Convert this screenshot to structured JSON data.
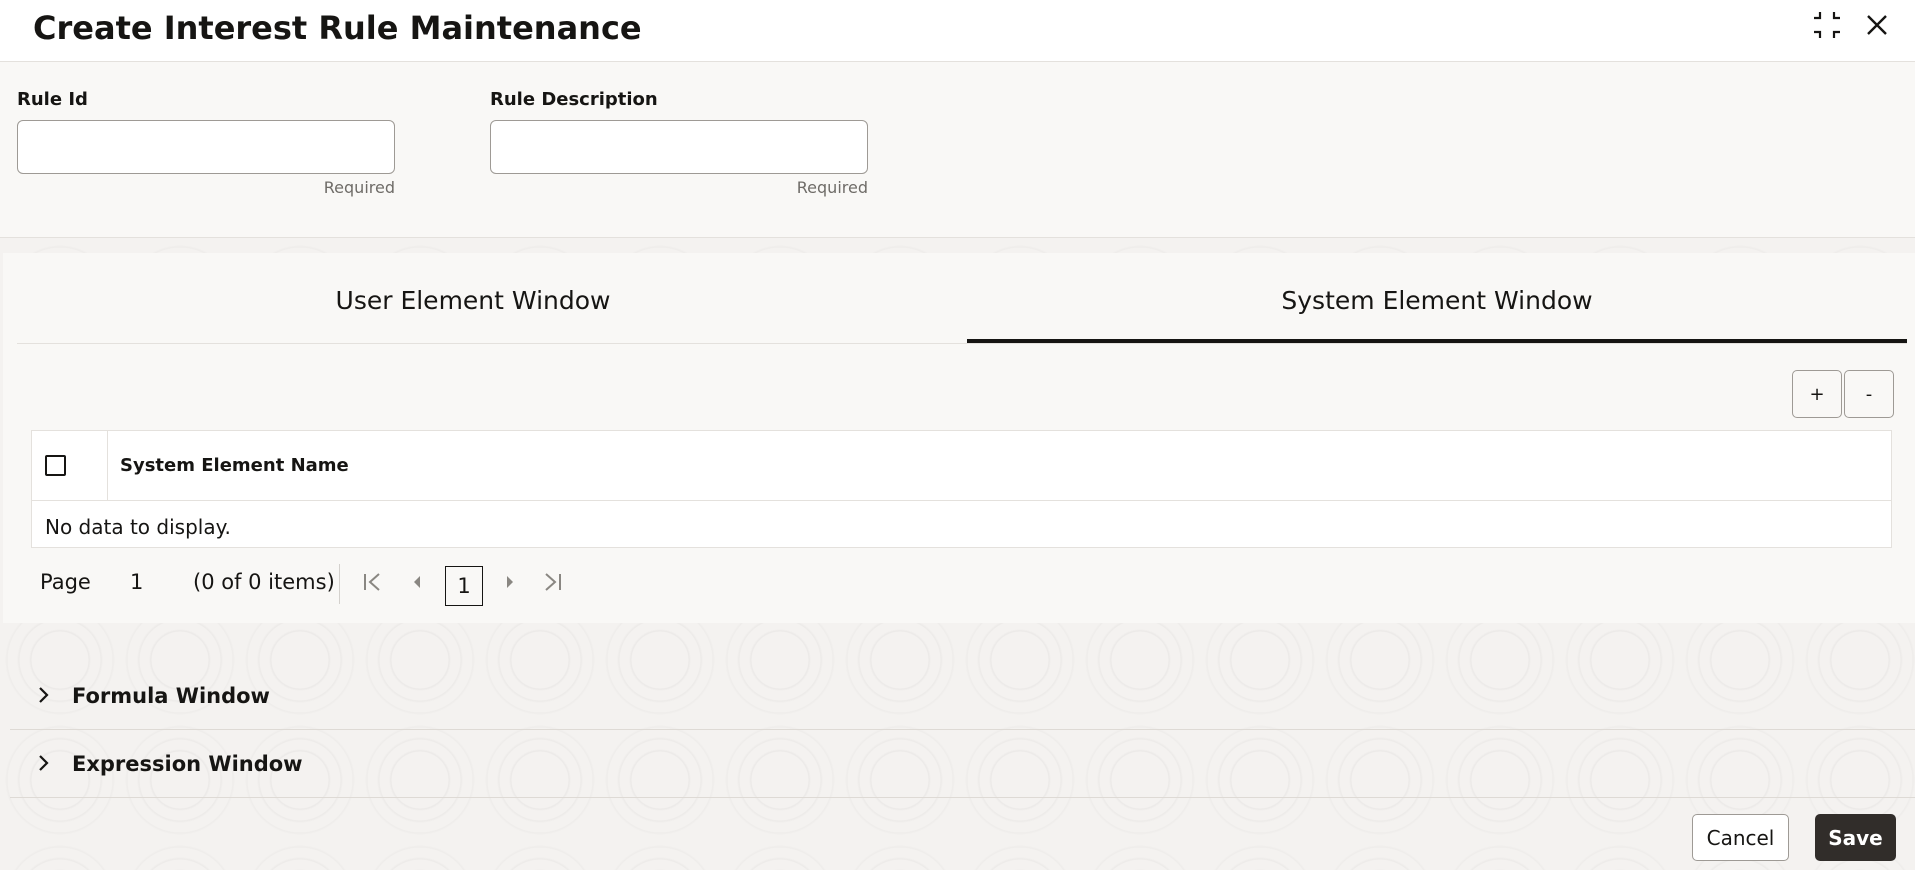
{
  "header": {
    "title": "Create Interest Rule Maintenance",
    "icons": [
      "compress-icon",
      "close-icon"
    ]
  },
  "form": {
    "rule_id": {
      "label": "Rule Id",
      "value": "",
      "hint": "Required"
    },
    "rule_description": {
      "label": "Rule Description",
      "value": "",
      "hint": "Required"
    }
  },
  "tabs": [
    {
      "label": "User Element Window",
      "selected": false
    },
    {
      "label": "System Element Window",
      "selected": true
    }
  ],
  "toolbar": {
    "add_label": "+",
    "remove_label": "-"
  },
  "grid": {
    "columns": [
      "System Element Name"
    ],
    "rows": [],
    "empty_text": "No data to display."
  },
  "pager": {
    "page_label": "Page",
    "page_number": "1",
    "items_text": "(0 of 0 items)",
    "current_page": "1"
  },
  "sections": [
    {
      "title": "Formula Window",
      "expanded": false
    },
    {
      "title": "Expression Window",
      "expanded": false
    }
  ],
  "footer": {
    "cancel_label": "Cancel",
    "save_label": "Save"
  },
  "colors": {
    "primary_button": "#312d2a",
    "text": "#161513",
    "border": "#9e9a95"
  }
}
